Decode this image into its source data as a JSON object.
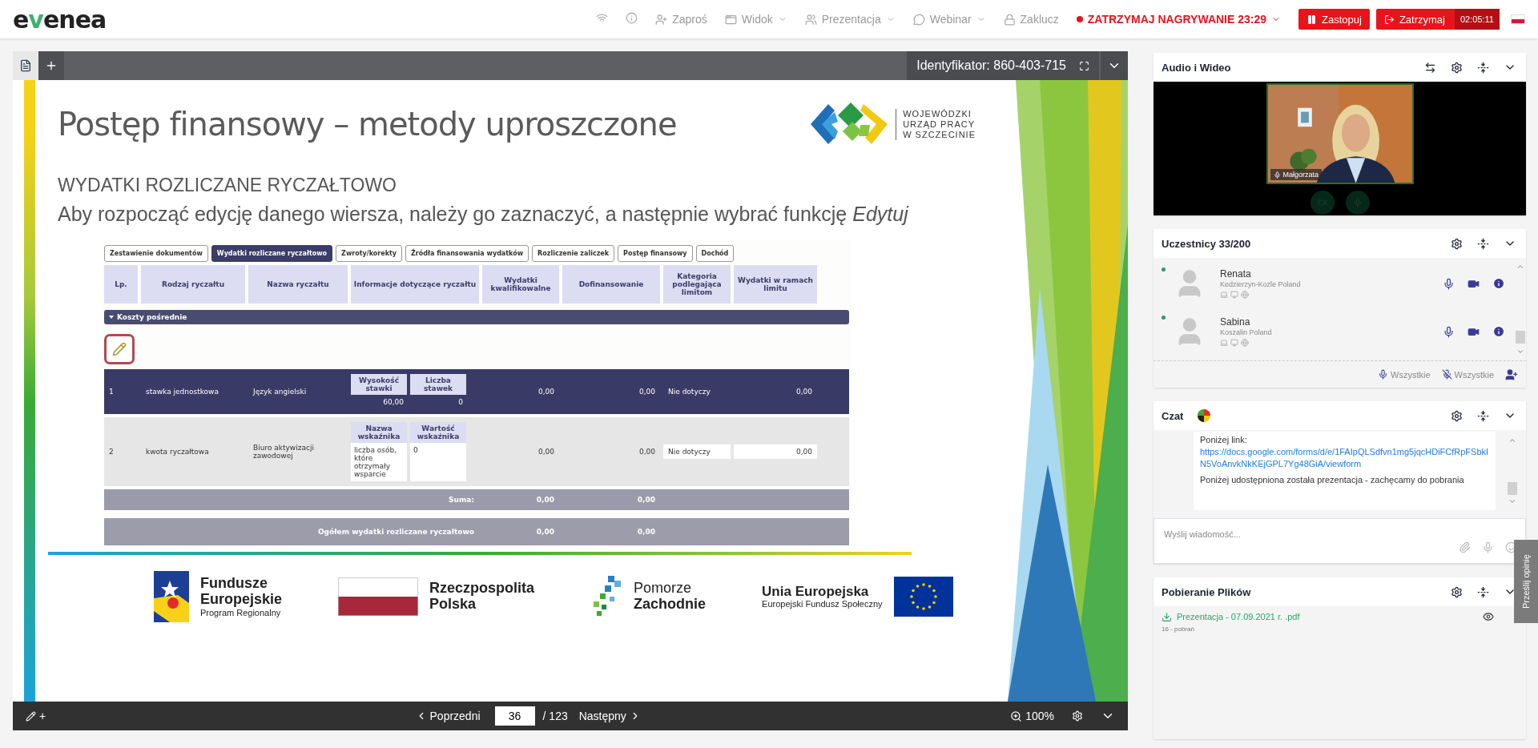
{
  "top_bar": {
    "logo": "evenea",
    "menu": [
      {
        "kind": "wifi"
      },
      {
        "kind": "info"
      },
      {
        "kind": "invite",
        "label": "Zaproś",
        "dropdown": false
      },
      {
        "kind": "view",
        "label": "Widok",
        "dropdown": true
      },
      {
        "kind": "presentation",
        "label": "Prezentacja",
        "dropdown": true
      },
      {
        "kind": "webinar",
        "label": "Webinar",
        "dropdown": true
      },
      {
        "kind": "lock",
        "label": "Zaklucz",
        "dropdown": false
      }
    ],
    "recording": "ZATRZYMAJ NAGRYWANIE 23:29",
    "buttons": [
      {
        "kind": "pause",
        "label": "Zastopuj"
      },
      {
        "kind": "stop",
        "label": "Zatrzymaj",
        "timer": "02:05:11"
      }
    ]
  },
  "presentation": {
    "identifier": "Identyfikator: 860-403-715",
    "slide": {
      "title": "Postęp finansowy – metody uproszczone",
      "logo": [
        "WOJEWÓDZKI",
        "URZĄD PRACY",
        "W SZCZECINIE"
      ],
      "heading": "WYDATKI ROZLICZANE RYCZAŁTOWO",
      "instruction": "Aby rozpocząć edycję danego wiersza, należy go zaznaczyć, a następnie wybrać funkcję *Edytuj*",
      "table": {
        "tabs": [
          {
            "label": "Zestawienie dokumentów",
            "selected": false
          },
          {
            "label": "Wydatki rozliczane ryczałtowo",
            "selected": true
          },
          {
            "label": "Zwroty/korekty",
            "selected": false
          },
          {
            "label": "Źródła finansowania wydatków",
            "selected": false
          },
          {
            "label": "Rozliczenie zaliczek",
            "selected": false
          },
          {
            "label": "Postęp finansowy",
            "selected": false
          },
          {
            "label": "Dochód",
            "selected": false
          }
        ],
        "columns": [
          "Lp.",
          "Rodzaj ryczałtu",
          "Nazwa ryczałtu",
          "Informacje dotyczące ryczałtu",
          "Wydatki kwalifikowalne",
          "Dofinansowanie",
          "Kategoria podlegająca limitom",
          "Wydatki w ramach limitu"
        ],
        "section": "Koszty pośrednie",
        "rows": [
          {
            "selected": true,
            "lp": "1",
            "type": "stawka jednostkowa",
            "name": "Język angielski",
            "info_headers": [
              "Wysokość stawki",
              "Liczba stawek"
            ],
            "info_values": [
              "60,00",
              "0"
            ],
            "qualified": "0,00",
            "funding": "0,00",
            "category": "Nie dotyczy",
            "within_limit": "0,00"
          },
          {
            "selected": false,
            "lp": "2",
            "type": "kwota ryczałtowa",
            "name": "Biuro aktywizacji zawodowej",
            "info_headers": [
              "Nazwa wskaźnika",
              "Wartość wskaźnika"
            ],
            "info_values": [
              "liczba osób, które otrzymały wsparcie",
              "0"
            ],
            "qualified": "0,00",
            "funding": "0,00",
            "category": "Nie dotyczy",
            "within_limit": "0,00"
          }
        ],
        "sum": {
          "label": "Suma:",
          "values": [
            "0,00",
            "0,00"
          ]
        },
        "total": {
          "label": "Ogółem wydatki rozliczane ryczałtowo",
          "values": [
            "0,00",
            "0,00"
          ]
        }
      },
      "footer_logos": [
        {
          "kind": "fundusze",
          "lines": [
            "Fundusze",
            "Europejskie"
          ],
          "subtitle": "Program Regionalny"
        },
        {
          "kind": "poland",
          "lines": [
            "Rzeczpospolita",
            "Polska"
          ]
        },
        {
          "kind": "pomorze",
          "lines": [
            "Pomorze",
            "Zachodnie"
          ]
        },
        {
          "kind": "eu",
          "lines": [
            "Unia Europejska"
          ],
          "subtitle": "Europejski Fundusz Społeczny"
        }
      ]
    },
    "toolbar": {
      "draw": "+",
      "previous": "Poprzedni",
      "page": "36",
      "total": "/ 123",
      "next": "Następny",
      "zoom": "100%"
    }
  },
  "audio_video": {
    "title": "Audio i Wideo",
    "speaker": "Małgorzata"
  },
  "participants": {
    "title": "Uczestnicy 33/200",
    "list": [
      {
        "name": "Renata",
        "location": "Kedzierzyn-Kozle Poland",
        "online": true
      },
      {
        "name": "Sabina",
        "location": "Koszalin Poland",
        "online": true
      }
    ],
    "mute_all": "Wszystkie",
    "unmute_all": "Wszystkie"
  },
  "chat": {
    "title": "Czat",
    "messages": [
      {
        "text": "Poniżej link:",
        "link": "https://docs.google.com/forms/d/e/1FAIpQLSdfvn1mg5jqcHDiFCfRpFSbkIN5VoAnvkNkKEjGPL7Yg48GiA/viewform"
      },
      {
        "text": "Poniżej udostępniona została prezentacja - zachęcamy do pobrania"
      }
    ],
    "placeholder": "Wyślij wiadomość..."
  },
  "files": {
    "title": "Pobieranie Plików",
    "items": [
      {
        "name": "Prezentacja - 07.09.2021 r. .pdf",
        "downloads": "16 - pobrań"
      }
    ]
  },
  "feedback": "Prześlij opinię"
}
